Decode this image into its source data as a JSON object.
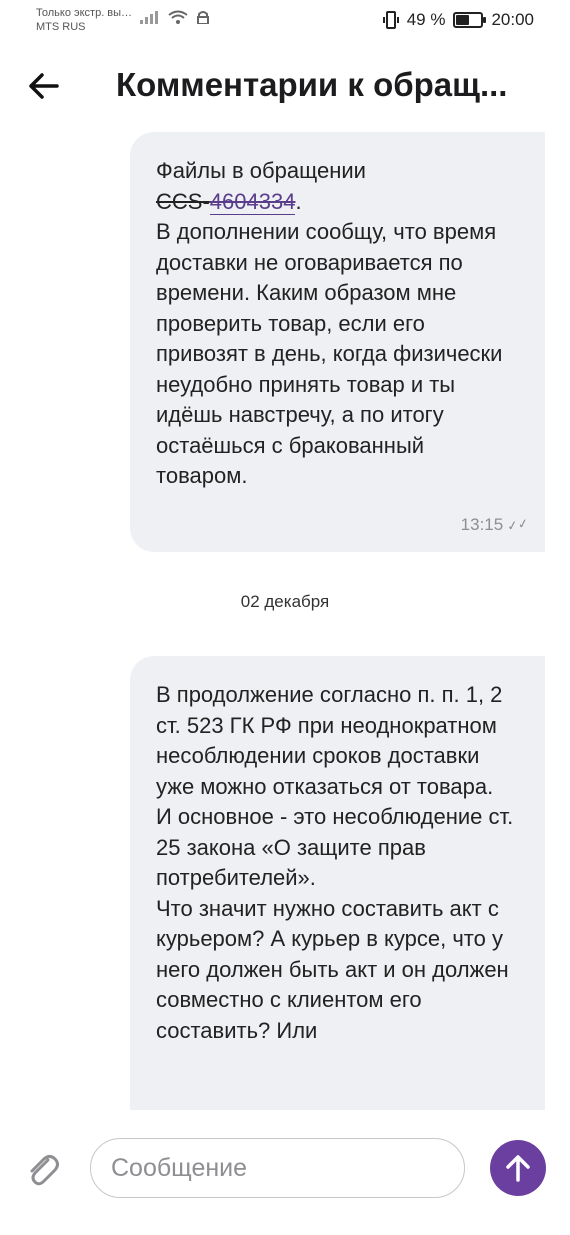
{
  "status_bar": {
    "carrier_line1": "Только экстр. вы…",
    "carrier_line2": "MTS RUS",
    "battery": "49 %",
    "battery_level": 0.49,
    "time": "20:00"
  },
  "header": {
    "title": "Комментарии к обращ..."
  },
  "messages": [
    {
      "files_label": "Файлы в обращении",
      "ccs_prefix": "CCS-",
      "ccs_code": "4604334",
      "ccs_suffix": ".",
      "body": "В дополнении сообщу, что время доставки не оговаривается по времени. Каким образом мне проверить товар, если его привозят в день, когда физически неудобно принять товар и ты идёшь навстречу, а по итогу остаёшься с бракованный товаром.",
      "time": "13:15"
    },
    {
      "body": "В продолжение согласно п. п. 1, 2 ст. 523 ГК РФ при неоднократном несоблюдении сроков доставки уже можно отказаться от товара.\nИ основное - это несоблюдение ст. 25 закона «О защите прав потребителей».\nЧто значит нужно составить акт с курьером? А курьер в курсе, что у него должен быть акт и он должен совместно с клиентом его составить? Или"
    }
  ],
  "date_separator": "02 декабря",
  "composer": {
    "placeholder": "Сообщение"
  },
  "colors": {
    "accent": "#6b3fa0",
    "bubble": "#eef0f3"
  },
  "icons": {
    "back": "arrow-left-icon",
    "attach": "paperclip-icon",
    "send": "arrow-up-icon"
  }
}
